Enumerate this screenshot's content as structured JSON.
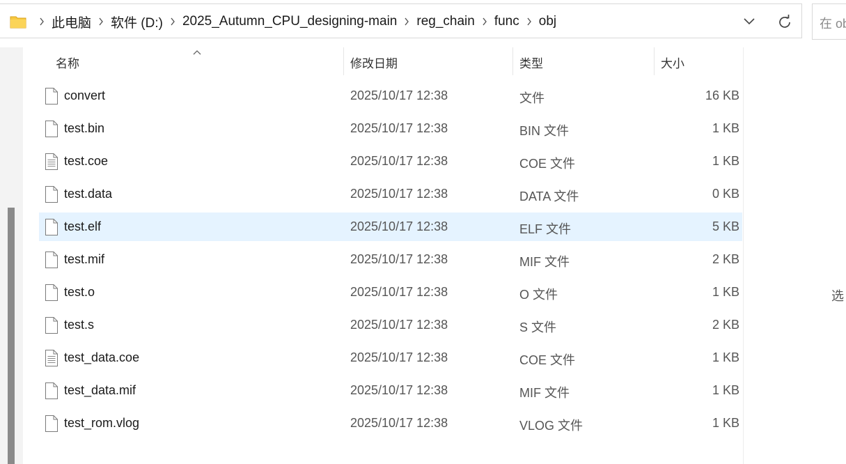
{
  "address": {
    "crumbs": [
      "此电脑",
      "软件 (D:)",
      "2025_Autumn_CPU_designing-main",
      "reg_chain",
      "func",
      "obj"
    ],
    "search_placeholder": "在 ob"
  },
  "columns": {
    "name": "名称",
    "date": "修改日期",
    "type": "类型",
    "size": "大小"
  },
  "files": [
    {
      "name": "convert",
      "date": "2025/10/17 12:38",
      "type": "文件",
      "size": "16 KB",
      "icon": "blank-file-icon"
    },
    {
      "name": "test.bin",
      "date": "2025/10/17 12:38",
      "type": "BIN 文件",
      "size": "1 KB",
      "icon": "blank-file-icon"
    },
    {
      "name": "test.coe",
      "date": "2025/10/17 12:38",
      "type": "COE 文件",
      "size": "1 KB",
      "icon": "text-file-icon"
    },
    {
      "name": "test.data",
      "date": "2025/10/17 12:38",
      "type": "DATA 文件",
      "size": "0 KB",
      "icon": "blank-file-icon"
    },
    {
      "name": "test.elf",
      "date": "2025/10/17 12:38",
      "type": "ELF 文件",
      "size": "5 KB",
      "icon": "blank-file-icon"
    },
    {
      "name": "test.mif",
      "date": "2025/10/17 12:38",
      "type": "MIF 文件",
      "size": "2 KB",
      "icon": "blank-file-icon"
    },
    {
      "name": "test.o",
      "date": "2025/10/17 12:38",
      "type": "O 文件",
      "size": "1 KB",
      "icon": "blank-file-icon"
    },
    {
      "name": "test.s",
      "date": "2025/10/17 12:38",
      "type": "S 文件",
      "size": "2 KB",
      "icon": "blank-file-icon"
    },
    {
      "name": "test_data.coe",
      "date": "2025/10/17 12:38",
      "type": "COE 文件",
      "size": "1 KB",
      "icon": "text-file-icon"
    },
    {
      "name": "test_data.mif",
      "date": "2025/10/17 12:38",
      "type": "MIF 文件",
      "size": "1 KB",
      "icon": "blank-file-icon"
    },
    {
      "name": "test_rom.vlog",
      "date": "2025/10/17 12:38",
      "type": "VLOG 文件",
      "size": "1 KB",
      "icon": "blank-file-icon"
    }
  ],
  "selected_file": "test.elf",
  "details_hint": "选",
  "colors": {
    "selection": "#e5f3ff",
    "folder": "#f8c941",
    "border": "#d8d8d8"
  }
}
